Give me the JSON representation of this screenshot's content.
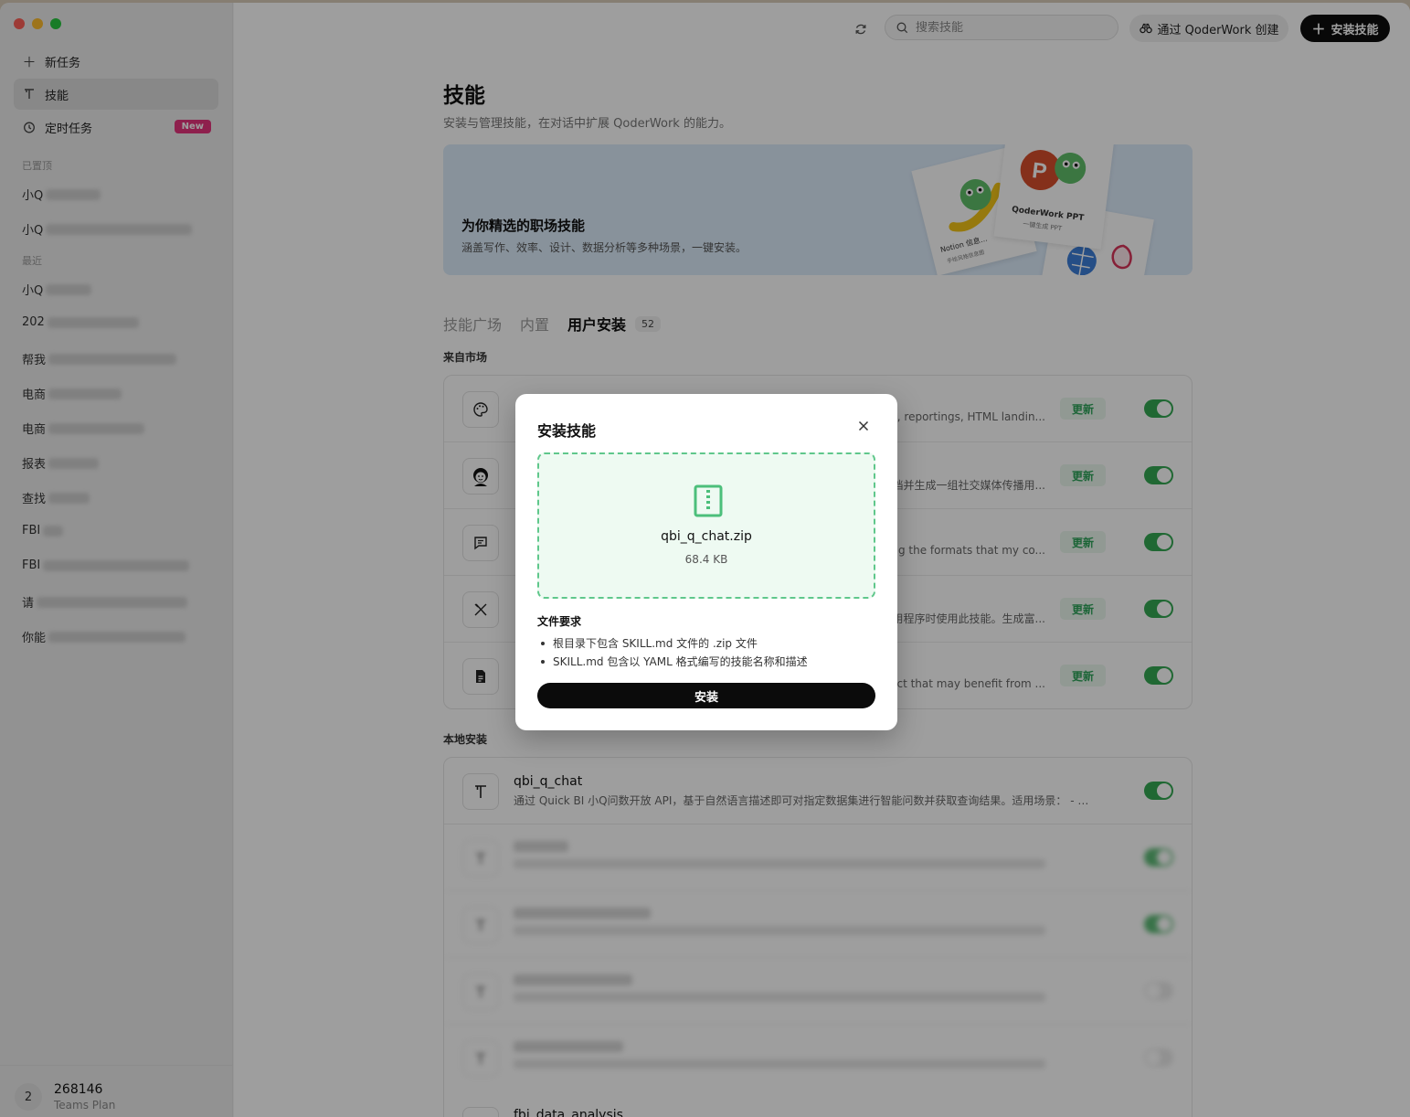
{
  "sidebar": {
    "nav": [
      {
        "label": "新任务",
        "icon": "plus-icon"
      },
      {
        "label": "技能",
        "icon": "skill-icon"
      },
      {
        "label": "定时任务",
        "icon": "clock-icon",
        "badge": "New"
      }
    ],
    "pinned_label": "已置顶",
    "pinned": [
      "小Q",
      "小Q"
    ],
    "recent_label": "最近",
    "recent": [
      "小Q",
      "202",
      "帮我",
      "电商",
      "电商",
      "报表",
      "查找",
      "FBI",
      "FBI",
      "请",
      "你能"
    ],
    "user": {
      "avatar": "2",
      "name": "268146",
      "plan": "Teams Plan"
    }
  },
  "topbar": {
    "search_placeholder": "搜索技能",
    "create_label": "通过 QoderWork 创建",
    "install_label": "安装技能"
  },
  "page": {
    "title": "技能",
    "subtitle": "安装与管理技能，在对话中扩展 QoderWork 的能力。",
    "banner": {
      "title": "为你精选的职场技能",
      "subtitle": "涵盖写作、效率、设计、数据分析等多种场景，一键安装。",
      "card_ppt": "QoderWork PPT",
      "card_ppt_sub": "一键生成 PPT",
      "card_notion": "Notion 信息…",
      "card_notion_sub": "手绘风格信息图"
    },
    "tabs": [
      {
        "label": "技能广场"
      },
      {
        "label": "内置"
      },
      {
        "label": "用户安装",
        "count": "52"
      }
    ],
    "market_label": "来自市场",
    "market_items": [
      {
        "desc": "s, reportings, HTML landin...",
        "update": "更新",
        "icon": "palette-icon"
      },
      {
        "desc": "档并生成一组社交媒体传播用...",
        "update": "更新",
        "icon": "avatar-icon"
      },
      {
        "desc": "sing the formats that my co...",
        "update": "更新",
        "icon": "message-icon"
      },
      {
        "desc": "用程序时使用此技能。生成富...",
        "update": "更新",
        "icon": "tools-icon"
      },
      {
        "desc": "fact that may benefit from ...",
        "update": "更新",
        "icon": "document-icon"
      }
    ],
    "local_label": "本地安装",
    "local_items": [
      {
        "name": "qbi_q_chat",
        "desc": "通过 Quick BI 小Q问数开放 API，基于自然语言描述即可对指定数据集进行智能问数并获取查询结果。适用场景： - 用..."
      },
      {
        "name": "fbi_data_analysis",
        "desc": ""
      }
    ]
  },
  "dialog": {
    "title": "安装技能",
    "file_name": "qbi_q_chat.zip",
    "file_size": "68.4 KB",
    "req_title": "文件要求",
    "requirements": [
      "根目录下包含 SKILL.md 文件的 .zip 文件",
      "SKILL.md 包含以 YAML 格式编写的技能名称和描述"
    ],
    "install_button": "安装"
  },
  "colors": {
    "accent_green": "#34a853",
    "badge_pink": "#e5357d",
    "primary_black": "#0d0d0d"
  }
}
